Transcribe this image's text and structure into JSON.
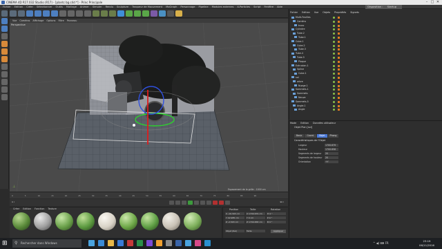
{
  "window": {
    "title": "CINEMA 4D R17.032 Studio (R17) - [plantc bg.c4d *] - Princ Principale",
    "controls": [
      "–",
      "□",
      "✕"
    ]
  },
  "menubar": {
    "items": [
      "Fichier",
      "Edition",
      "Créer",
      "Sélectionner",
      "Outils",
      "Maillage",
      "Animer",
      "Simuler",
      "Rendu",
      "Sculpture",
      "Traqueur de Mouvement",
      "MoGraph",
      "Personnage",
      "Pipeline",
      "Modules externes",
      "X-Particles",
      "Script",
      "Fenêtre",
      "Aide"
    ],
    "layout_label": "Disposition :",
    "layout_value": "Startup"
  },
  "viewport": {
    "menu": [
      "Vue",
      "Caméras",
      "Affichage",
      "Options",
      "Filtre",
      "Panneau"
    ],
    "label": "Perspective",
    "grid_info": "Espacement de la grille : 1000 cm"
  },
  "timeline": {
    "frames": [
      "0",
      "5",
      "10",
      "15",
      "20",
      "25",
      "30",
      "35",
      "40",
      "45",
      "50",
      "55",
      "60",
      "65",
      "70",
      "75",
      "80",
      "85",
      "90"
    ],
    "current": "0 I",
    "start": "0 I",
    "end": "90 I"
  },
  "materials": {
    "menu": [
      "Créer",
      "Edition",
      "Fonction",
      "Texture"
    ],
    "colors": [
      "#5a8a3a",
      "#a0a0a0",
      "#6aa04a",
      "#5c9a40",
      "#d8d2c6",
      "#6ea848",
      "#5f9f45",
      "#c9c2b6",
      "#7cae5a"
    ]
  },
  "coords": {
    "headers": [
      "Position",
      "Taille",
      "Rotation"
    ],
    "rows": [
      [
        "X  -19.303 cm",
        "X  1700.679 cm",
        "H  0 °"
      ],
      [
        "Y  42.985 cm",
        "Y  0 cm",
        "P  0 °"
      ],
      [
        "Z  -2.593 cm",
        "Z  1700.658 cm",
        "B  0 °"
      ]
    ],
    "mode_object": "Objet (Rel)",
    "mode_size": "Taille",
    "apply_label": "Appliquer"
  },
  "object_manager": {
    "menu": [
      "Fichier",
      "Edition",
      "Vue",
      "Objets",
      "Propriétés",
      "Signets"
    ],
    "rows": [
      "Multi-Feuilles",
      "Caméra",
      "tronc",
      "Cylindre",
      "Tube.2",
      "Tube.1",
      "Cube.1",
      "Cube.2",
      "Tube.3",
      "Tube.4",
      "Tube.5",
      "Plaque",
      "Extrusion.1",
      "Spline",
      "Cube.1",
      "sol",
      "arbre",
      "Nuage.1",
      "Sommets.1",
      "Sommets",
      "Neuve",
      "Sommets.5",
      "Angle.1",
      "Angle"
    ]
  },
  "attributes": {
    "menu": [
      "Mode",
      "Edition",
      "Données utilisateur"
    ],
    "object": "Objet Plan [sol]",
    "tabs": [
      "Basic",
      "Coord.",
      "Objet",
      "Phong"
    ],
    "active_tab": "Objet",
    "section": "Caractéristiques de l'Objet",
    "fields": [
      {
        "label": "Largeur",
        "value": "1700.679"
      },
      {
        "label": "Hauteur",
        "value": "1700.658"
      },
      {
        "label": "Segments de largeur",
        "value": "20"
      },
      {
        "label": "Segments de hauteur",
        "value": "20"
      },
      {
        "label": "Orientation",
        "value": "+Y"
      }
    ]
  },
  "taskbar": {
    "search_placeholder": "Rechercher dans Windows",
    "tray": "^  ◀)  ⌨  FR",
    "time": "23:19",
    "date": "06/11/2016",
    "app_colors": [
      "#4aa3df",
      "#3b8bd6",
      "#e8b84a",
      "#3b7bd6",
      "#c53b3b",
      "#2a8f4a",
      "#7b4ad6",
      "#f0a030",
      "#8a8a8a",
      "#3a64a8",
      "#4aa3df",
      "#d64a8a",
      "#2a8fcf"
    ]
  }
}
